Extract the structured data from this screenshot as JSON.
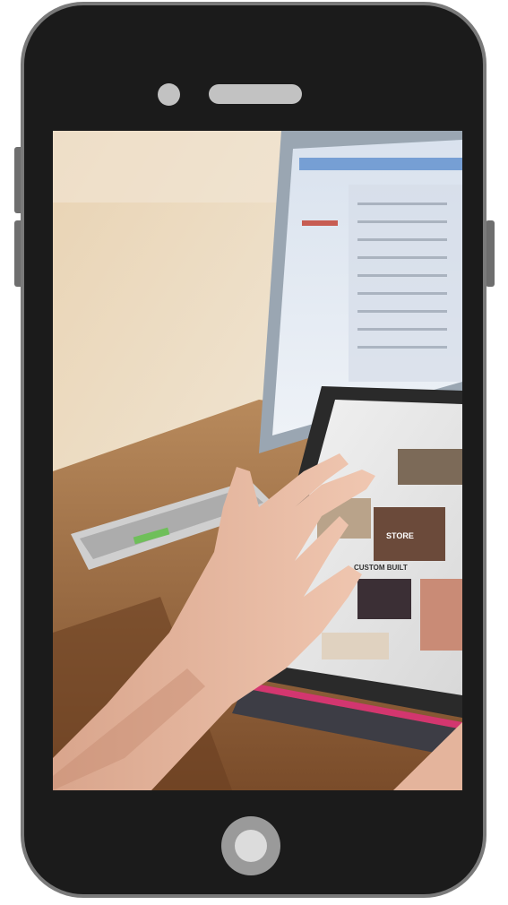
{
  "device": {
    "type": "smartphone",
    "frame_color": "#1b1b1b",
    "bezel_color": "#7a7a7a",
    "screen_content": "photo"
  },
  "screen_photo": {
    "tablet_labels": {
      "store_text": "STORE",
      "custom_built_text": "CUSTOM BUILT"
    }
  },
  "icons": {
    "camera": "camera-dot-icon",
    "speaker": "speaker-grille-icon",
    "home": "home-button-icon"
  },
  "colors": {
    "wall": "#eadbc3",
    "desk": "#8a5a32",
    "skin": "#e3b49c",
    "laptop_screen": "#e6ecf4",
    "accent_pink": "#e0307a"
  }
}
